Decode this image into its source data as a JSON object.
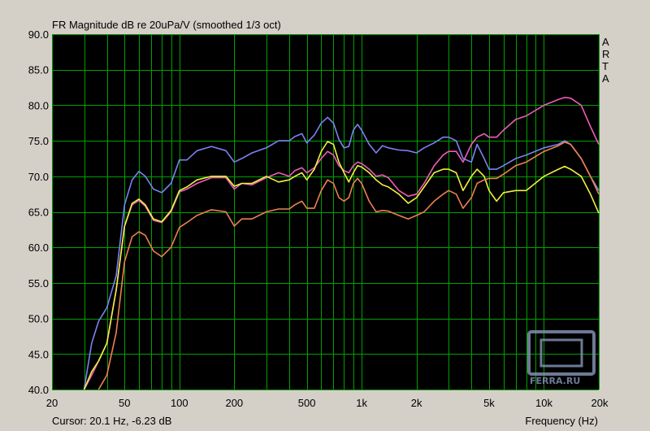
{
  "title": "FR Magnitude dB re 20uPa/V (smoothed 1/3 oct)",
  "brand_letters": [
    "A",
    "R",
    "T",
    "A"
  ],
  "cursor_text": "Cursor: 20.1 Hz, -6.23 dB",
  "watermark": "FERRA.RU",
  "colors": {
    "background": "#d4d0c8",
    "plot_background": "#000000",
    "grid": "#00a000"
  },
  "chart_data": {
    "type": "line",
    "title": "FR Magnitude dB re 20uPa/V (smoothed 1/3 oct)",
    "xlabel": "Frequency (Hz)",
    "ylabel": "",
    "x_scale": "log",
    "xlim": [
      20,
      20000
    ],
    "ylim": [
      40,
      90
    ],
    "grid": true,
    "y_ticks": [
      "90.0",
      "85.0",
      "80.0",
      "75.0",
      "70.0",
      "65.0",
      "60.0",
      "55.0",
      "50.0",
      "45.0",
      "40.0"
    ],
    "x_ticks": [
      {
        "v": 20,
        "label": "20"
      },
      {
        "v": 50,
        "label": "50"
      },
      {
        "v": 100,
        "label": "100"
      },
      {
        "v": 200,
        "label": "200"
      },
      {
        "v": 500,
        "label": "500"
      },
      {
        "v": 1000,
        "label": "1k"
      },
      {
        "v": 2000,
        "label": "2k"
      },
      {
        "v": 5000,
        "label": "5k"
      },
      {
        "v": 10000,
        "label": "10k"
      },
      {
        "v": 20000,
        "label": "20k"
      }
    ],
    "series": [
      {
        "color": "#7b83f0",
        "points": [
          [
            30,
            40
          ],
          [
            33,
            46.5
          ],
          [
            36,
            49.6
          ],
          [
            40,
            51.5
          ],
          [
            45,
            56
          ],
          [
            50,
            66
          ],
          [
            55,
            69.5
          ],
          [
            60,
            70.7
          ],
          [
            65,
            70
          ],
          [
            72,
            68.2
          ],
          [
            80,
            67.7
          ],
          [
            90,
            69
          ],
          [
            100,
            72.3
          ],
          [
            110,
            72.3
          ],
          [
            125,
            73.6
          ],
          [
            150,
            74.2
          ],
          [
            180,
            73.6
          ],
          [
            200,
            72
          ],
          [
            220,
            72.5
          ],
          [
            250,
            73.3
          ],
          [
            300,
            74
          ],
          [
            350,
            75
          ],
          [
            400,
            75
          ],
          [
            430,
            75.6
          ],
          [
            470,
            76
          ],
          [
            500,
            74.7
          ],
          [
            550,
            75.8
          ],
          [
            600,
            77.5
          ],
          [
            650,
            78.3
          ],
          [
            700,
            77.5
          ],
          [
            750,
            75.2
          ],
          [
            800,
            74
          ],
          [
            850,
            74.2
          ],
          [
            900,
            76.5
          ],
          [
            950,
            77.3
          ],
          [
            1000,
            76.5
          ],
          [
            1100,
            74.5
          ],
          [
            1200,
            73.3
          ],
          [
            1300,
            74.3
          ],
          [
            1400,
            74
          ],
          [
            1600,
            73.7
          ],
          [
            1800,
            73.6
          ],
          [
            2000,
            73.3
          ],
          [
            2200,
            74
          ],
          [
            2500,
            74.7
          ],
          [
            2800,
            75.5
          ],
          [
            3000,
            75.5
          ],
          [
            3300,
            75
          ],
          [
            3600,
            72.5
          ],
          [
            4000,
            72
          ],
          [
            4300,
            74.5
          ],
          [
            4700,
            72.5
          ],
          [
            5000,
            71
          ],
          [
            5500,
            71
          ],
          [
            6000,
            71.5
          ],
          [
            7000,
            72.5
          ],
          [
            8000,
            73
          ],
          [
            10000,
            74
          ],
          [
            12000,
            74.5
          ],
          [
            13000,
            75
          ],
          [
            14000,
            74.5
          ],
          [
            16000,
            72.5
          ],
          [
            18000,
            70
          ],
          [
            20000,
            68
          ]
        ]
      },
      {
        "color": "#ee5dbb",
        "points": [
          [
            30,
            40
          ],
          [
            33,
            42
          ],
          [
            36,
            44
          ],
          [
            40,
            46.5
          ],
          [
            45,
            54
          ],
          [
            50,
            63
          ],
          [
            55,
            66
          ],
          [
            60,
            66.6
          ],
          [
            65,
            65.8
          ],
          [
            72,
            63.8
          ],
          [
            80,
            63.5
          ],
          [
            90,
            65
          ],
          [
            100,
            67.8
          ],
          [
            110,
            68.2
          ],
          [
            125,
            69
          ],
          [
            150,
            69.8
          ],
          [
            180,
            69.8
          ],
          [
            200,
            68.2
          ],
          [
            220,
            69
          ],
          [
            250,
            68.8
          ],
          [
            300,
            69.8
          ],
          [
            350,
            70.5
          ],
          [
            400,
            70
          ],
          [
            430,
            70.8
          ],
          [
            470,
            71.2
          ],
          [
            500,
            70.5
          ],
          [
            550,
            71.2
          ],
          [
            600,
            72.5
          ],
          [
            650,
            73.5
          ],
          [
            700,
            73
          ],
          [
            750,
            71.5
          ],
          [
            800,
            70.8
          ],
          [
            850,
            70.5
          ],
          [
            900,
            71.5
          ],
          [
            950,
            72
          ],
          [
            1000,
            71.8
          ],
          [
            1100,
            71
          ],
          [
            1200,
            70
          ],
          [
            1300,
            70.2
          ],
          [
            1400,
            69.8
          ],
          [
            1600,
            68
          ],
          [
            1800,
            67.2
          ],
          [
            2000,
            67.5
          ],
          [
            2200,
            69
          ],
          [
            2500,
            71.5
          ],
          [
            2800,
            73
          ],
          [
            3000,
            73.5
          ],
          [
            3300,
            73.5
          ],
          [
            3600,
            72
          ],
          [
            4000,
            74.5
          ],
          [
            4300,
            75.5
          ],
          [
            4700,
            76
          ],
          [
            5000,
            75.5
          ],
          [
            5500,
            75.5
          ],
          [
            6000,
            76.5
          ],
          [
            7000,
            78
          ],
          [
            8000,
            78.5
          ],
          [
            10000,
            80
          ],
          [
            12000,
            80.8
          ],
          [
            13000,
            81.1
          ],
          [
            14000,
            81
          ],
          [
            16000,
            80
          ],
          [
            18000,
            77
          ],
          [
            20000,
            74.5
          ]
        ]
      },
      {
        "color": "#f0f040",
        "points": [
          [
            30,
            40
          ],
          [
            33,
            42.5
          ],
          [
            36,
            44
          ],
          [
            40,
            46.5
          ],
          [
            45,
            54
          ],
          [
            50,
            63
          ],
          [
            55,
            66.2
          ],
          [
            60,
            66.8
          ],
          [
            65,
            66
          ],
          [
            72,
            64
          ],
          [
            80,
            63.6
          ],
          [
            90,
            65.2
          ],
          [
            100,
            68
          ],
          [
            110,
            68.5
          ],
          [
            125,
            69.5
          ],
          [
            150,
            70
          ],
          [
            180,
            70
          ],
          [
            200,
            68.6
          ],
          [
            220,
            69
          ],
          [
            250,
            69
          ],
          [
            300,
            70
          ],
          [
            350,
            69.2
          ],
          [
            400,
            69.5
          ],
          [
            430,
            70
          ],
          [
            470,
            70.5
          ],
          [
            500,
            69.5
          ],
          [
            550,
            71
          ],
          [
            600,
            73.5
          ],
          [
            650,
            74.9
          ],
          [
            700,
            74.5
          ],
          [
            750,
            72
          ],
          [
            800,
            70.5
          ],
          [
            850,
            69.2
          ],
          [
            900,
            70.5
          ],
          [
            950,
            71.5
          ],
          [
            1000,
            71.3
          ],
          [
            1100,
            70.5
          ],
          [
            1200,
            69.5
          ],
          [
            1300,
            68.8
          ],
          [
            1400,
            68.5
          ],
          [
            1600,
            67.5
          ],
          [
            1800,
            66.2
          ],
          [
            2000,
            67
          ],
          [
            2200,
            68.5
          ],
          [
            2500,
            70.5
          ],
          [
            2800,
            71
          ],
          [
            3000,
            71
          ],
          [
            3300,
            70.5
          ],
          [
            3600,
            68
          ],
          [
            4000,
            70
          ],
          [
            4300,
            71
          ],
          [
            4700,
            70
          ],
          [
            5000,
            68
          ],
          [
            5500,
            66.5
          ],
          [
            6000,
            67.7
          ],
          [
            7000,
            68
          ],
          [
            8000,
            68
          ],
          [
            10000,
            70
          ],
          [
            12000,
            71
          ],
          [
            13000,
            71.4
          ],
          [
            14000,
            71
          ],
          [
            16000,
            70
          ],
          [
            18000,
            67.5
          ],
          [
            20000,
            64.8
          ]
        ]
      },
      {
        "color": "#f08050",
        "points": [
          [
            36,
            40
          ],
          [
            40,
            42
          ],
          [
            45,
            48
          ],
          [
            50,
            58
          ],
          [
            55,
            61.5
          ],
          [
            60,
            62.2
          ],
          [
            65,
            61.7
          ],
          [
            72,
            59.5
          ],
          [
            80,
            58.7
          ],
          [
            90,
            60
          ],
          [
            100,
            62.8
          ],
          [
            110,
            63.5
          ],
          [
            125,
            64.5
          ],
          [
            150,
            65.3
          ],
          [
            180,
            65
          ],
          [
            200,
            63
          ],
          [
            220,
            64
          ],
          [
            250,
            64
          ],
          [
            300,
            65
          ],
          [
            350,
            65.4
          ],
          [
            400,
            65.4
          ],
          [
            430,
            66
          ],
          [
            470,
            66.5
          ],
          [
            500,
            65.5
          ],
          [
            550,
            65.5
          ],
          [
            600,
            68
          ],
          [
            650,
            69.5
          ],
          [
            700,
            69
          ],
          [
            750,
            67
          ],
          [
            800,
            66.5
          ],
          [
            850,
            67
          ],
          [
            900,
            69
          ],
          [
            950,
            69.7
          ],
          [
            1000,
            69
          ],
          [
            1100,
            66.5
          ],
          [
            1200,
            65
          ],
          [
            1300,
            65.2
          ],
          [
            1400,
            65.1
          ],
          [
            1600,
            64.5
          ],
          [
            1800,
            64
          ],
          [
            2000,
            64.5
          ],
          [
            2200,
            65
          ],
          [
            2500,
            66.5
          ],
          [
            2800,
            67.5
          ],
          [
            3000,
            68
          ],
          [
            3300,
            67.5
          ],
          [
            3600,
            65.5
          ],
          [
            4000,
            67
          ],
          [
            4300,
            69
          ],
          [
            4700,
            69.5
          ],
          [
            5000,
            69.7
          ],
          [
            5500,
            69.7
          ],
          [
            6000,
            70.3
          ],
          [
            7000,
            71.5
          ],
          [
            8000,
            72
          ],
          [
            10000,
            73.5
          ],
          [
            12000,
            74.3
          ],
          [
            13000,
            74.8
          ],
          [
            14000,
            74.5
          ],
          [
            16000,
            72.5
          ],
          [
            18000,
            70
          ],
          [
            20000,
            67.5
          ]
        ]
      }
    ]
  }
}
